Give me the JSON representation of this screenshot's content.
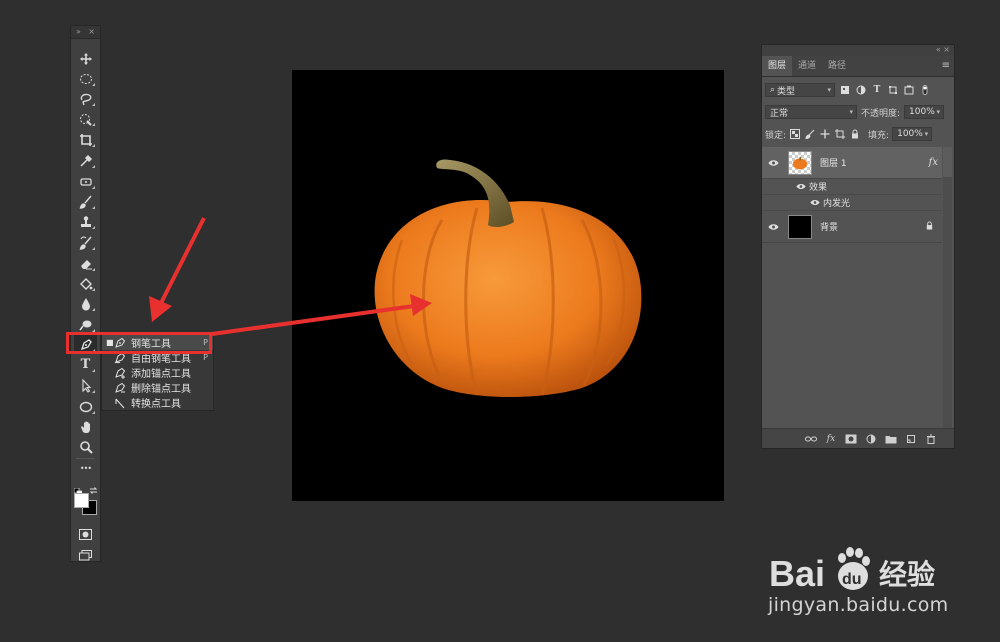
{
  "toolbar": {
    "collapse_glyph": "»",
    "close_glyph": "×",
    "tools": [
      {
        "name": "move-tool",
        "icon": "move-icon"
      },
      {
        "name": "marquee-tool",
        "icon": "ellipse-marquee-icon"
      },
      {
        "name": "lasso-tool",
        "icon": "lasso-icon"
      },
      {
        "name": "quick-select-tool",
        "icon": "quick-select-icon"
      },
      {
        "name": "crop-tool",
        "icon": "crop-icon"
      },
      {
        "name": "eyedropper-tool",
        "icon": "eyedropper-icon"
      },
      {
        "name": "healing-tool",
        "icon": "healing-brush-icon"
      },
      {
        "name": "brush-tool",
        "icon": "brush-icon"
      },
      {
        "name": "stamp-tool",
        "icon": "clone-stamp-icon"
      },
      {
        "name": "history-brush-tool",
        "icon": "history-brush-icon"
      },
      {
        "name": "eraser-tool",
        "icon": "eraser-icon"
      },
      {
        "name": "paint-bucket-tool",
        "icon": "paint-bucket-icon"
      },
      {
        "name": "blur-tool",
        "icon": "blur-icon"
      },
      {
        "name": "dodge-tool",
        "icon": "dodge-icon"
      },
      {
        "name": "pen-tool",
        "icon": "pen-icon"
      },
      {
        "name": "type-tool",
        "icon": "type-icon"
      },
      {
        "name": "path-select-tool",
        "icon": "path-select-icon"
      },
      {
        "name": "shape-tool",
        "icon": "ellipse-shape-icon"
      },
      {
        "name": "hand-tool",
        "icon": "hand-icon"
      },
      {
        "name": "zoom-tool",
        "icon": "zoom-icon"
      },
      {
        "name": "more-tools",
        "icon": "ellipsis-icon"
      }
    ],
    "type_glyph": "T",
    "more_glyph": "•••"
  },
  "pen_flyout": {
    "items": [
      {
        "label": "钢笔工具",
        "key": "P",
        "selected": true,
        "icon": "pen-icon"
      },
      {
        "label": "自由钢笔工具",
        "key": "P",
        "selected": false,
        "icon": "freeform-pen-icon"
      },
      {
        "label": "添加锚点工具",
        "key": "",
        "selected": false,
        "icon": "add-anchor-icon"
      },
      {
        "label": "删除锚点工具",
        "key": "",
        "selected": false,
        "icon": "delete-anchor-icon"
      },
      {
        "label": "转换点工具",
        "key": "",
        "selected": false,
        "icon": "convert-point-icon"
      }
    ]
  },
  "layers_panel": {
    "top_glyphs": "«  ×",
    "tabs": [
      {
        "label": "图层",
        "active": true
      },
      {
        "label": "通道",
        "active": false
      },
      {
        "label": "路径",
        "active": false
      }
    ],
    "menu_glyph": "≡",
    "filter": {
      "search_glyph": "⌕",
      "label": "类型"
    },
    "blend_mode": "正常",
    "opacity_label": "不透明度:",
    "opacity_value": "100%",
    "lock_label": "锁定:",
    "fill_label": "填充:",
    "fill_value": "100%",
    "layers": [
      {
        "name": "图层 1",
        "fx": "fx",
        "selected": true
      },
      {
        "name": "背景",
        "selected": false
      }
    ],
    "effects_label": "效果",
    "effect_item": "内发光"
  },
  "colors": {
    "highlight_red": "#e8312f",
    "workspace": "#2f2f2f",
    "pumpkin_orange": "#ee7a1f",
    "stem": "#7a6a3a"
  },
  "watermark": {
    "brand": "Baidu经验",
    "url": "jingyan.baidu.com"
  }
}
